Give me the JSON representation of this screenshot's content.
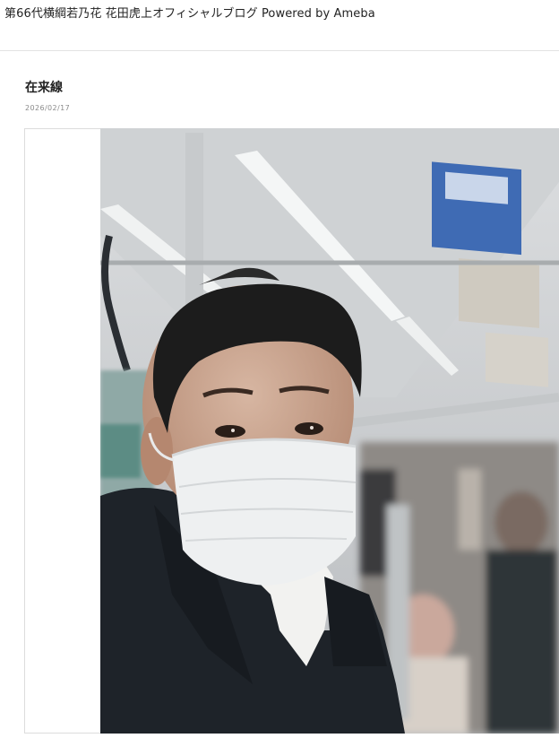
{
  "header": {
    "blog_title": "第66代横綱若乃花 花田虎上オフィシャルブログ Powered by Ameba"
  },
  "entry": {
    "title": "在来線",
    "date": "2026/02/17",
    "photo_alt": "在来線"
  },
  "colors": {
    "border": "#dcdcdc",
    "date_text": "#8a8a8a",
    "title_text": "#222222"
  }
}
